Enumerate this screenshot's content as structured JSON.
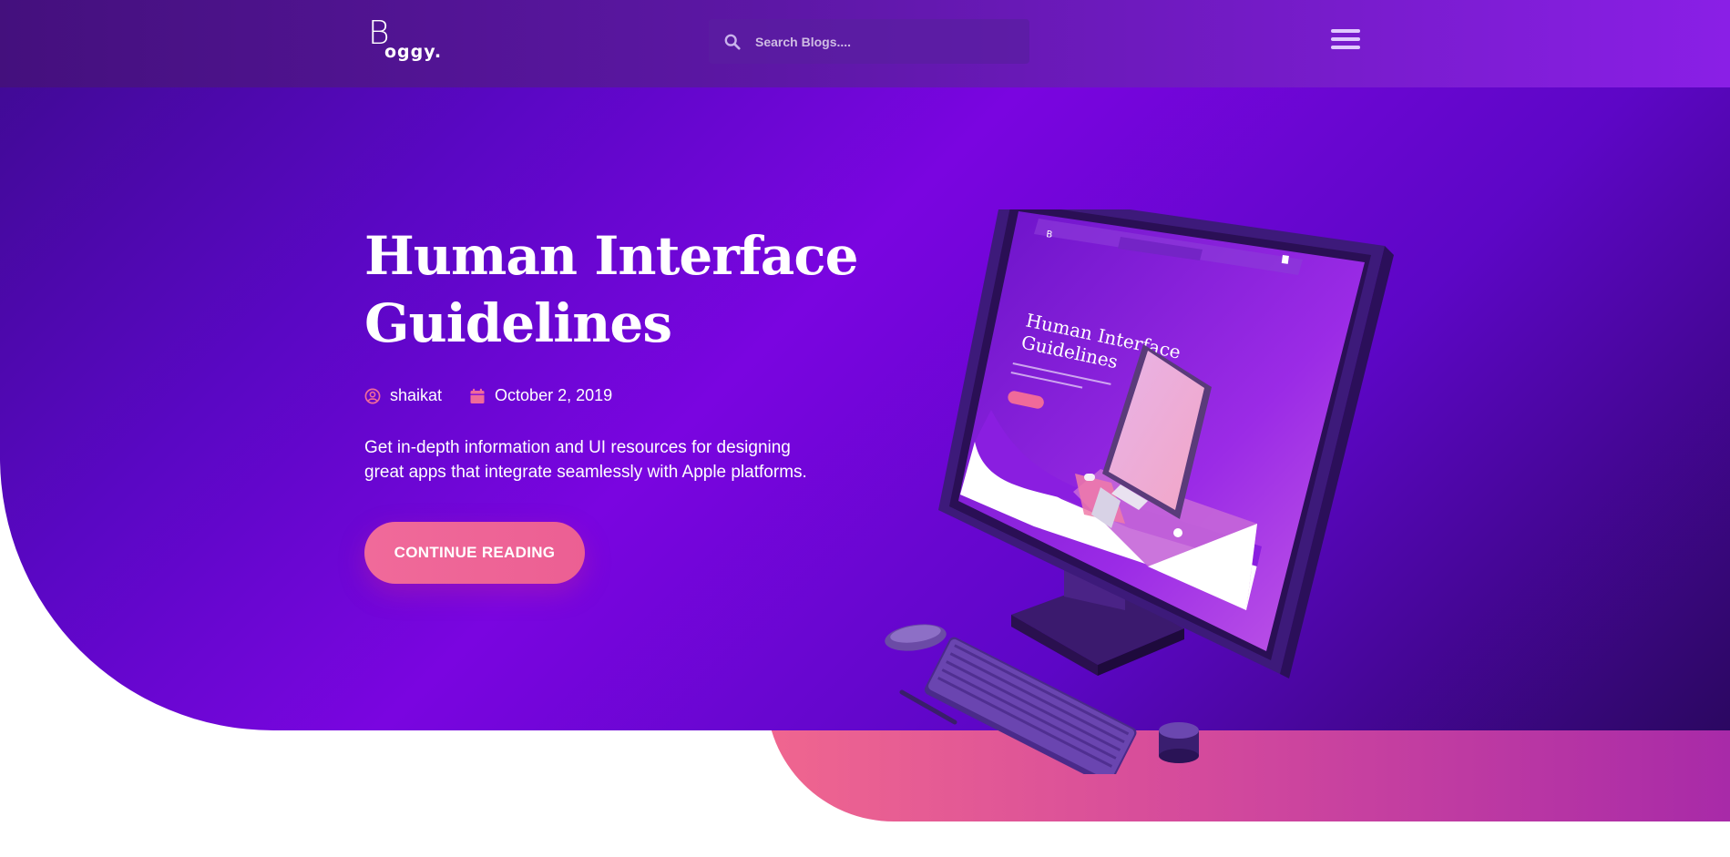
{
  "header": {
    "logo": {
      "initial": "B",
      "wordmark": "oggy."
    },
    "search": {
      "placeholder": "Search Blogs...."
    },
    "menu_icon": "hamburger-icon"
  },
  "hero": {
    "title_line1": "Human Interface",
    "title_line2": "Guidelines",
    "author": "shaikat",
    "date": "October 2, 2019",
    "description_line1": "Get in-depth information and UI resources for designing",
    "description_line2": "great apps that integrate seamlessly with Apple platforms.",
    "cta_label": "CONTINUE READING",
    "author_icon": "user-icon",
    "date_icon": "calendar-icon",
    "illustration": {
      "screen_title_line1": "Human Interface",
      "screen_title_line2": "Guidelines"
    }
  },
  "colors": {
    "primary_purple": "#7a05e0",
    "accent_pink": "#f06a9a",
    "header_bg": "#5d17a6"
  }
}
